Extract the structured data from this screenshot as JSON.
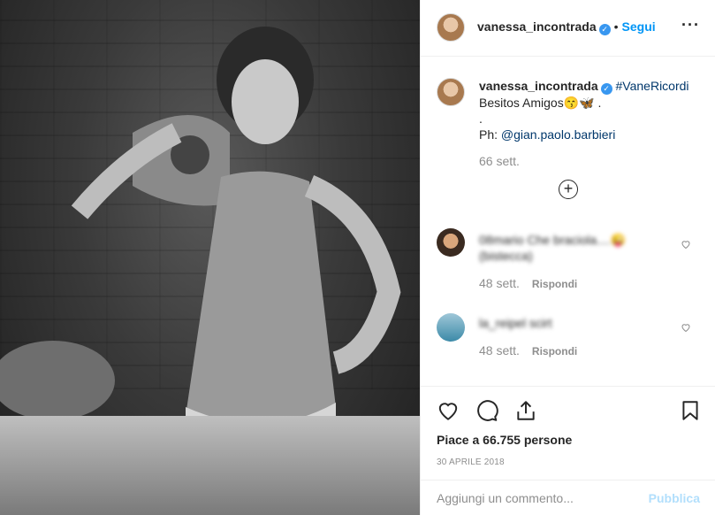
{
  "post": {
    "username": "vanessa_incontrada",
    "follow_label": "Segui",
    "more_icon": "more-options-icon"
  },
  "caption": {
    "username": "vanessa_incontrada",
    "hashtag": "#VaneRicordi",
    "line1": "Besitos Amigos😙🦋 .",
    "line2": ".",
    "ph_prefix": "Ph: ",
    "ph_mention": "@gian.paolo.barbieri",
    "time": "66 sett."
  },
  "comments": [
    {
      "text_line1": "08mario Che braciola....😜",
      "text_line2": "(bistecca)",
      "time": "48 sett.",
      "reply": "Rispondi"
    },
    {
      "text_line1": "la_reipel scirt",
      "time": "48 sett.",
      "reply": "Rispondi"
    }
  ],
  "actions": {
    "likes_text": "Piace a 66.755 persone",
    "date": "30 APRILE 2018"
  },
  "add_comment": {
    "placeholder": "Aggiungi un commento...",
    "publish_label": "Pubblica"
  },
  "colors": {
    "accent": "#0095f6",
    "publish_disabled": "#b2dffc",
    "muted": "#8e8e8e",
    "verified": "#3897f0"
  }
}
